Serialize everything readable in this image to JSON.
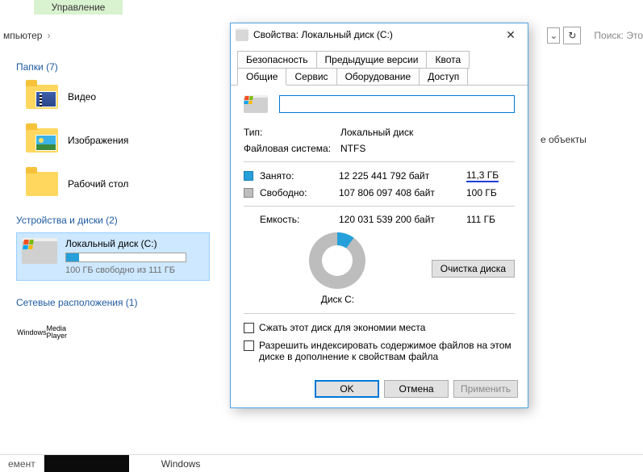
{
  "ribbon": {
    "manage": "Управление"
  },
  "breadcrumb": {
    "computer": "мпьютер",
    "chev": "›"
  },
  "toolbar": {
    "dropdown_glyph": "⌄",
    "refresh_glyph": "↻",
    "search_placeholder": "Поиск: Это"
  },
  "groups": {
    "folders": "Папки (7)",
    "devices": "Устройства и диски (2)",
    "network": "Сетевые расположения (1)"
  },
  "folders": {
    "video": "Видео",
    "images": "Изображения",
    "desktop": "Рабочий стол"
  },
  "drive": {
    "title": "Локальный диск (C:)",
    "sub": "100 ГБ свободно из 111 ГБ"
  },
  "wmp": {
    "l1": "Windows",
    "l2": "Media Player"
  },
  "net_empty": "е объекты",
  "statusbar": {
    "element": "емент",
    "windows": "Windows"
  },
  "dialog": {
    "title": "Свойства: Локальный диск (C:)",
    "close": "✕",
    "tabs_row1": [
      "Безопасность",
      "Предыдущие версии",
      "Квота"
    ],
    "tabs_row2": [
      "Общие",
      "Сервис",
      "Оборудование",
      "Доступ"
    ],
    "active_tab": "Общие",
    "name_value": "",
    "type_k": "Тип:",
    "type_v": "Локальный диск",
    "fs_k": "Файловая система:",
    "fs_v": "NTFS",
    "used_k": "Занято:",
    "used_bytes": "12 225 441 792 байт",
    "used_gb": "11,3 ГБ",
    "free_k": "Свободно:",
    "free_bytes": "107 806 097 408 байт",
    "free_gb": "100 ГБ",
    "cap_k": "Емкость:",
    "cap_bytes": "120 031 539 200 байт",
    "cap_gb": "111 ГБ",
    "donut_label": "Диск C:",
    "cleanup": "Очистка диска",
    "cb1": "Сжать этот диск для экономии места",
    "cb2": "Разрешить индексировать содержимое файлов на этом диске в дополнение к свойствам файла",
    "ok": "OK",
    "cancel": "Отмена",
    "apply": "Применить"
  }
}
